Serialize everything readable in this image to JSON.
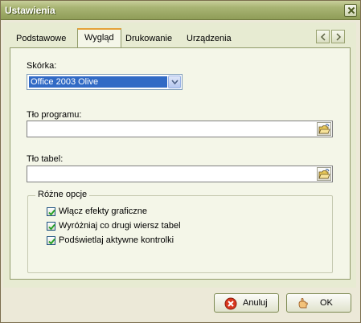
{
  "window": {
    "title": "Ustawienia"
  },
  "tabs": [
    {
      "label": "Podstawowe",
      "active": false
    },
    {
      "label": "Wygląd",
      "active": true
    },
    {
      "label": "Drukowanie",
      "active": false
    },
    {
      "label": "Urządzenia",
      "active": false
    }
  ],
  "skin": {
    "label": "Skórka:",
    "selected": "Office 2003 Olive"
  },
  "program_background": {
    "label": "Tło programu:",
    "value": ""
  },
  "table_background": {
    "label": "Tło tabel:",
    "value": ""
  },
  "options": {
    "legend": "Różne opcje",
    "items": [
      {
        "label": "Włącz efekty graficzne",
        "checked": true
      },
      {
        "label": "Wyróżniaj co drugi wiersz tabel",
        "checked": true
      },
      {
        "label": "Podświetlaj aktywne kontrolki",
        "checked": true
      }
    ]
  },
  "buttons": {
    "cancel": "Anuluj",
    "ok": "OK"
  },
  "colors": {
    "titlebar": "#a9b574",
    "panel": "#f4f6e8",
    "selection": "#316ac5",
    "active_tab_accent": "#e5a23a"
  }
}
